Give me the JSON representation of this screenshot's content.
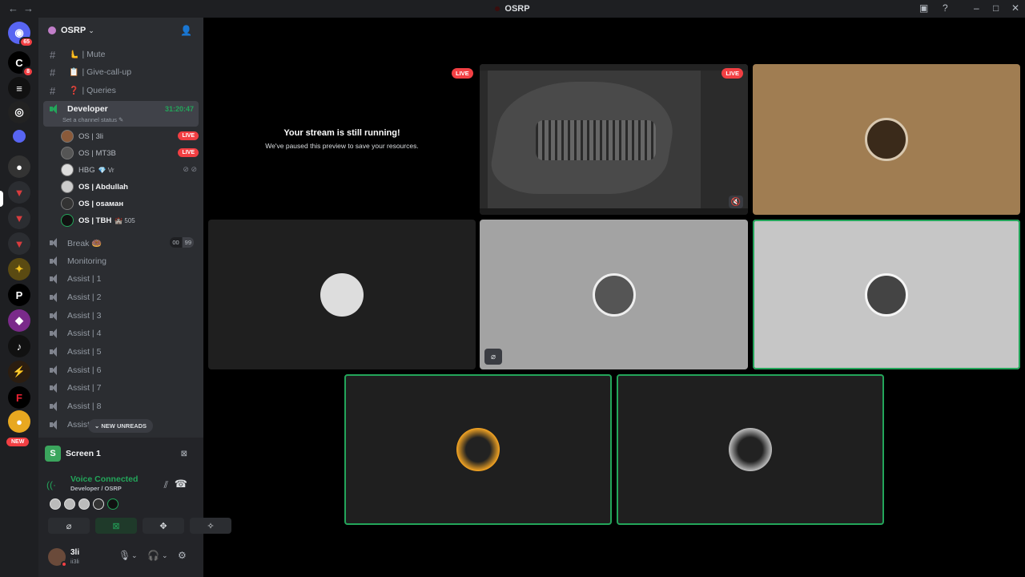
{
  "window": {
    "title": "OSRP"
  },
  "guilds": {
    "home_badge": "65",
    "second_badge": "8",
    "new_label": "NEW"
  },
  "server": {
    "name": "OSRP"
  },
  "channels": [
    {
      "type": "text",
      "emoji": "🫷",
      "name": "| Mute"
    },
    {
      "type": "text",
      "emoji": "📋",
      "name": "| Give-call-up"
    },
    {
      "type": "text",
      "emoji": "❓",
      "name": "| Queries"
    }
  ],
  "active_channel": {
    "name": "Developer",
    "timer": "31:20:47",
    "status": "Set a channel status"
  },
  "voice_users": [
    {
      "name": "OS | 3li",
      "live": "LIVE"
    },
    {
      "name": "OS | MT3B",
      "live": "LIVE"
    },
    {
      "name": "HBG",
      "extra": "💎 Vr"
    },
    {
      "name": "OS | Abdullah"
    },
    {
      "name": "OS | osaмaн"
    },
    {
      "name": "OS | TBH",
      "extra": "🏰 505"
    }
  ],
  "voice_channels": [
    {
      "name": "Break 🍩",
      "count_a": "00",
      "count_b": "99"
    },
    {
      "name": "Monitoring"
    },
    {
      "name": "Assist | 1"
    },
    {
      "name": "Assist | 2"
    },
    {
      "name": "Assist | 3"
    },
    {
      "name": "Assist | 4"
    },
    {
      "name": "Assist | 5"
    },
    {
      "name": "Assist | 6"
    },
    {
      "name": "Assist | 7"
    },
    {
      "name": "Assist | 8"
    },
    {
      "name": "Assist |"
    }
  ],
  "new_unreads": "NEW UNREADS",
  "panel": {
    "screen_label": "Screen 1",
    "voice_connected": "Voice Connected",
    "voice_location": "Developer / OSRP"
  },
  "user": {
    "name": "3li",
    "status": "ii3li"
  },
  "stage": {
    "paused_title": "Your stream is still running!",
    "paused_sub": "We've paused this preview to save your resources.",
    "live_label": "LIVE"
  },
  "colors": {
    "accent_green": "#23a55a",
    "live_red": "#f23f43"
  }
}
